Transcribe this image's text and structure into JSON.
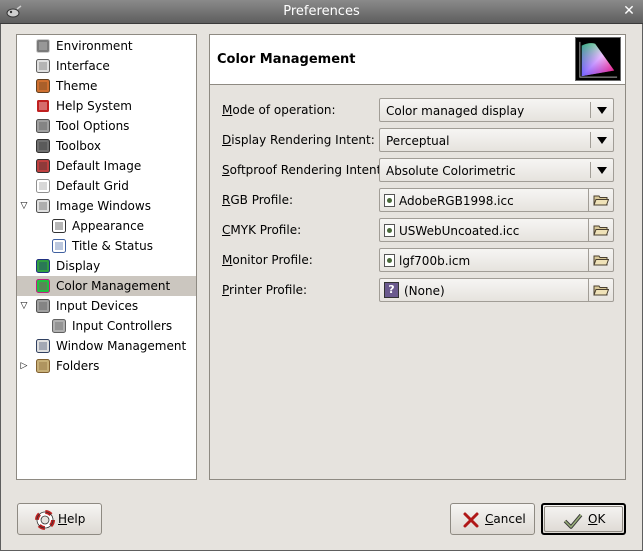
{
  "window": {
    "title": "Preferences",
    "close_glyph": "✕"
  },
  "tree": {
    "items": [
      {
        "label": "Environment",
        "icon": "environment-icon",
        "level": 0,
        "expander": ""
      },
      {
        "label": "Interface",
        "icon": "interface-icon",
        "level": 0,
        "expander": ""
      },
      {
        "label": "Theme",
        "icon": "theme-icon",
        "level": 0,
        "expander": ""
      },
      {
        "label": "Help System",
        "icon": "help-system-icon",
        "level": 0,
        "expander": ""
      },
      {
        "label": "Tool Options",
        "icon": "tool-options-icon",
        "level": 0,
        "expander": ""
      },
      {
        "label": "Toolbox",
        "icon": "toolbox-icon",
        "level": 0,
        "expander": ""
      },
      {
        "label": "Default Image",
        "icon": "default-image-icon",
        "level": 0,
        "expander": ""
      },
      {
        "label": "Default Grid",
        "icon": "default-grid-icon",
        "level": 0,
        "expander": ""
      },
      {
        "label": "Image Windows",
        "icon": "image-windows-icon",
        "level": 0,
        "expander": "▽"
      },
      {
        "label": "Appearance",
        "icon": "appearance-icon",
        "level": 1,
        "expander": ""
      },
      {
        "label": "Title & Status",
        "icon": "title-status-icon",
        "level": 1,
        "expander": ""
      },
      {
        "label": "Display",
        "icon": "display-icon",
        "level": 0,
        "expander": ""
      },
      {
        "label": "Color Management",
        "icon": "color-management-icon",
        "level": 0,
        "expander": "",
        "selected": true
      },
      {
        "label": "Input Devices",
        "icon": "input-devices-icon",
        "level": 0,
        "expander": "▽"
      },
      {
        "label": "Input Controllers",
        "icon": "input-controllers-icon",
        "level": 1,
        "expander": ""
      },
      {
        "label": "Window Management",
        "icon": "window-management-icon",
        "level": 0,
        "expander": ""
      },
      {
        "label": "Folders",
        "icon": "folders-icon",
        "level": 0,
        "expander": "▷"
      }
    ]
  },
  "panel": {
    "title": "Color Management",
    "icon": "color-gamut-icon",
    "fields": [
      {
        "label_pre": "",
        "label_ul": "M",
        "label_post": "ode of operation:",
        "kind": "combo",
        "value": "Color managed display"
      },
      {
        "label_pre": "",
        "label_ul": "D",
        "label_post": "isplay Rendering Intent:",
        "kind": "combo",
        "value": "Perceptual"
      },
      {
        "label_pre": "",
        "label_ul": "S",
        "label_post": "oftproof Rendering Intent:",
        "kind": "combo",
        "value": "Absolute Colorimetric"
      },
      {
        "label_pre": "",
        "label_ul": "R",
        "label_post": "GB Profile:",
        "kind": "file",
        "value": "AdobeRGB1998.icc"
      },
      {
        "label_pre": "",
        "label_ul": "C",
        "label_post": "MYK Profile:",
        "kind": "file",
        "value": "USWebUncoated.icc"
      },
      {
        "label_pre": "",
        "label_ul": "M",
        "label_post": "onitor Profile:",
        "kind": "file",
        "value": "lgf700b.icm"
      },
      {
        "label_pre": "",
        "label_ul": "P",
        "label_post": "rinter Profile:",
        "kind": "file-none",
        "value": "(None)",
        "unknown_glyph": "?"
      }
    ]
  },
  "buttons": {
    "help": {
      "ul": "H",
      "rest": "elp"
    },
    "cancel": {
      "ul": "C",
      "rest": "ancel"
    },
    "ok": {
      "ul": "O",
      "rest": "K"
    }
  }
}
